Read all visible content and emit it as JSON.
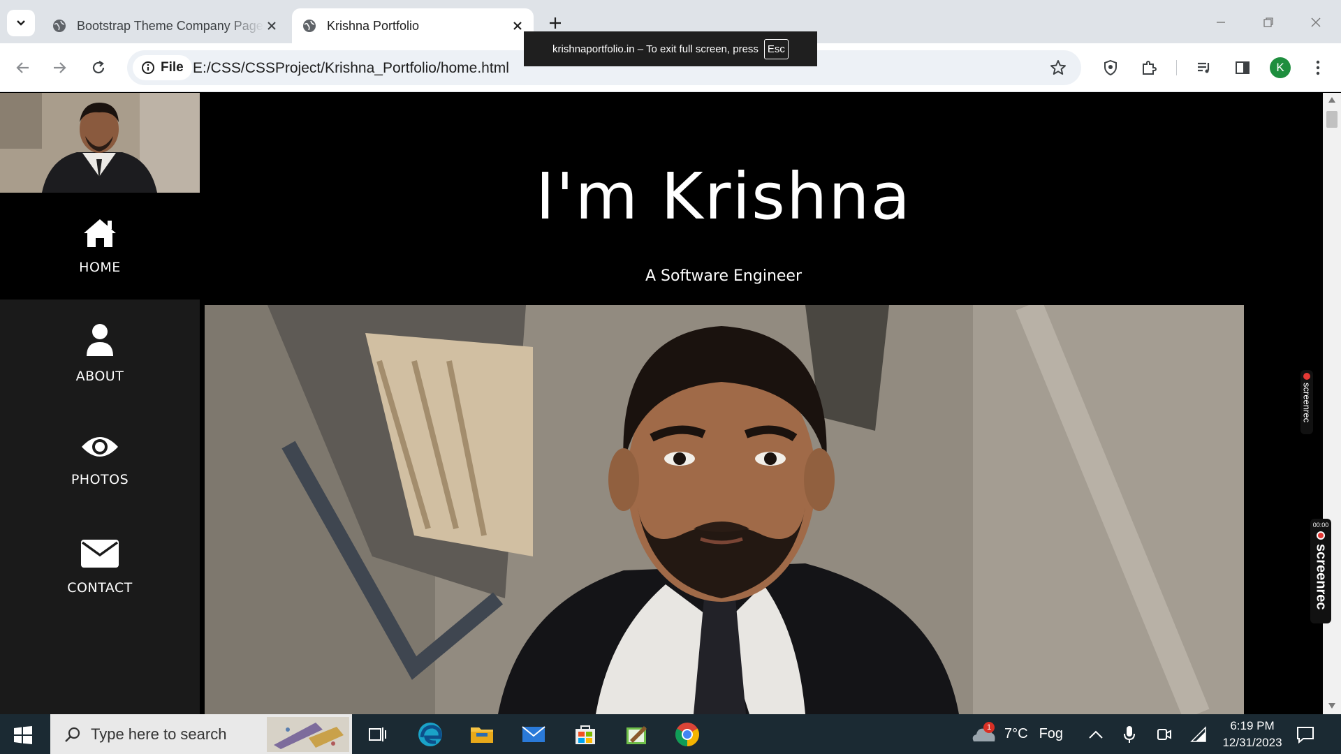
{
  "browser": {
    "tabs": [
      {
        "title": "Bootstrap Theme Company Page",
        "active": false
      },
      {
        "title": "Krishna Portfolio",
        "active": true
      }
    ],
    "site_chip_label": "File",
    "url": "E:/CSS/CSSProject/Krishna_Portfolio/home.html",
    "profile_initial": "K",
    "profile_color": "#1e8e3e"
  },
  "fullscreen_toast": {
    "message": "krishnaportfolio.in – To exit full screen, press",
    "key": "Esc"
  },
  "page": {
    "sidebar": {
      "items": [
        {
          "label": "HOME",
          "icon": "home-icon"
        },
        {
          "label": "ABOUT",
          "icon": "user-icon"
        },
        {
          "label": "PHOTOS",
          "icon": "eye-icon"
        },
        {
          "label": "CONTACT",
          "icon": "envelope-icon"
        }
      ]
    },
    "hero": {
      "title": "I'm Krishna",
      "subtitle": "A Software Engineer"
    }
  },
  "overlays": {
    "recorder_label": "screenrec",
    "recorder_timer": "00:00"
  },
  "taskbar": {
    "search_placeholder": "Type here to search",
    "weather": {
      "temp": "7°C",
      "condition": "Fog",
      "badge": "1"
    },
    "time": "6:19 PM",
    "date": "12/31/2023"
  }
}
